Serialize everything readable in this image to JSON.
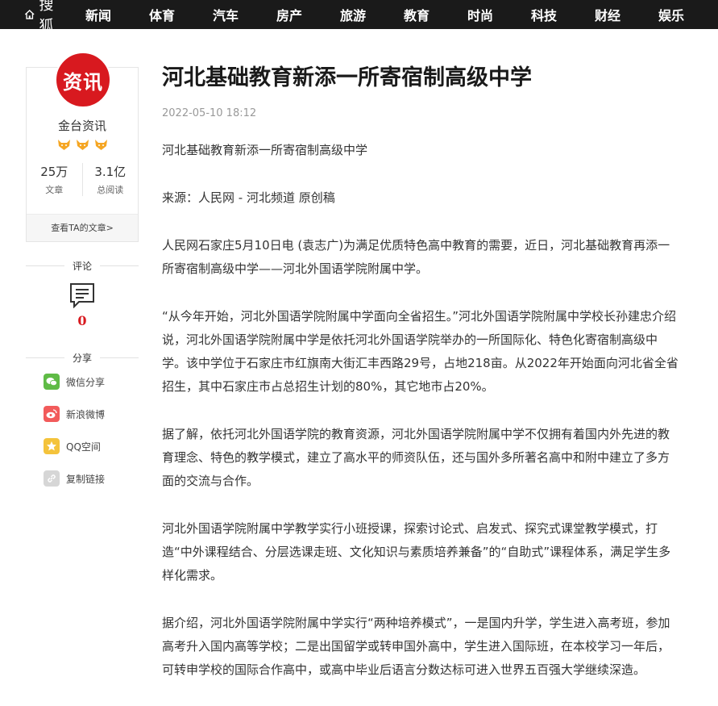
{
  "header": {
    "brand": "搜狐",
    "nav": [
      "新闻",
      "体育",
      "汽车",
      "房产",
      "旅游",
      "教育",
      "时尚",
      "科技",
      "财经",
      "娱乐"
    ]
  },
  "author": {
    "avatar_text": "资讯",
    "name": "金台资讯",
    "stats": [
      {
        "value": "25万",
        "label": "文章"
      },
      {
        "value": "3.1亿",
        "label": "总阅读"
      }
    ],
    "more_link": "查看TA的文章>"
  },
  "comments": {
    "title": "评论",
    "count": "0"
  },
  "share": {
    "title": "分享",
    "items": [
      {
        "label": "微信分享",
        "icon": "wechat-icon",
        "color": "#5fbb46"
      },
      {
        "label": "新浪微博",
        "icon": "weibo-icon",
        "color": "#f25b5b"
      },
      {
        "label": "QQ空间",
        "icon": "qzone-icon",
        "color": "#f4c33b"
      },
      {
        "label": "复制链接",
        "icon": "link-icon",
        "color": "#d6d6d6"
      }
    ]
  },
  "article": {
    "title": "河北基础教育新添一所寄宿制高级中学",
    "time": "2022-05-10 18:12",
    "paragraphs": [
      "河北基础教育新添一所寄宿制高级中学",
      "来源：人民网 - 河北频道 原创稿",
      "人民网石家庄5月10日电 (袁志广)为满足优质特色高中教育的需要，近日，河北基础教育再添一所寄宿制高级中学——河北外国语学院附属中学。",
      "“从今年开始，河北外国语学院附属中学面向全省招生。”河北外国语学院附属中学校长孙建忠介绍说，河北外国语学院附属中学是依托河北外国语学院举办的一所国际化、特色化寄宿制高级中学。该中学位于石家庄市红旗南大街汇丰西路29号，占地218亩。从2022年开始面向河北省全省招生，其中石家庄市占总招生计划的80%，其它地市占20%。",
      "据了解，依托河北外国语学院的教育资源，河北外国语学院附属中学不仅拥有着国内外先进的教育理念、特色的教学模式，建立了高水平的师资队伍，还与国外多所著名高中和附中建立了多方面的交流与合作。",
      "河北外国语学院附属中学教学实行小班授课，探索讨论式、启发式、探究式课堂教学模式，打造“中外课程结合、分层选课走班、文化知识与素质培养兼备”的“自助式”课程体系，满足学生多样化需求。",
      "据介绍，河北外国语学院附属中学实行“两种培养模式”，一是国内升学，学生进入高考班，参加高考升入国内高等学校；二是出国留学或转申国外高中，学生进入国际班，在本校学习一年后，可转申学校的国际合作高中，或高中毕业后语言分数达标可进入世界五百强大学继续深造。"
    ]
  }
}
